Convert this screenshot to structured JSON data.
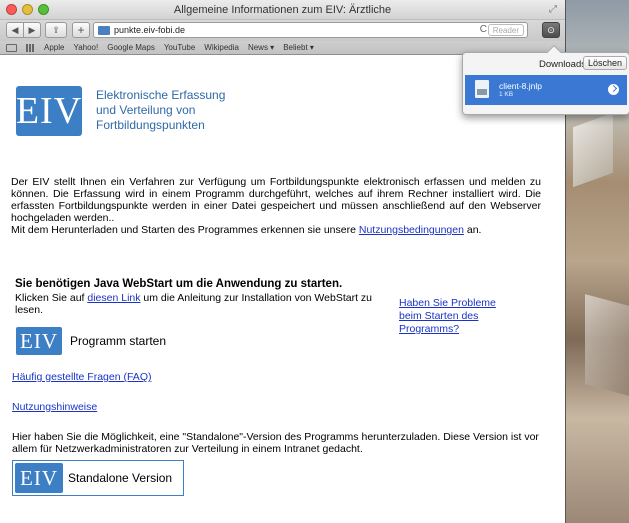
{
  "window": {
    "title": "Allgemeine Informationen zum EIV: Ärztliche"
  },
  "toolbar": {
    "back_glyph": "◀",
    "forward_glyph": "▶",
    "share_glyph": "⇪",
    "add_glyph": "+",
    "url": "punkte.eiv-fobi.de",
    "reload_glyph": "C",
    "reader_label": "Reader",
    "downloads_glyph": "⊙"
  },
  "bookmarks": {
    "items": [
      "Apple",
      "Yahoo!",
      "Google Maps",
      "YouTube",
      "Wikipedia",
      "News ▾",
      "Beliebt ▾"
    ]
  },
  "page": {
    "logo_text": "EIV",
    "logo_title": [
      "Elektronische Erfassung",
      "und Verteilung von",
      "Fortbildungspunkten"
    ],
    "intro_text": "Der EIV stellt Ihnen ein Verfahren zur Verfügung um Fortbildungspunkte elektronisch erfassen und melden zu können. Die Erfassung wird in einem Programm durchgeführt, welches auf ihrem Rechner installiert wird. Die erfassten Fortbildungspunkte werden in einer Datei gespeichert und müssen anschließend auf den Webserver hochgeladen werden..",
    "intro_text2": "Mit dem Herunterladen und Starten des Programmes erkennen sie unsere ",
    "terms_link": "Nutzungsbedingungen",
    "intro_end": " an.",
    "java_heading": "Sie benötigen Java WebStart um die Anwendung zu starten.",
    "java_text_pre": "Klicken Sie auf ",
    "java_link": "diesen Link",
    "java_text_post": " um die Anleitung zur Installation von WebStart zu lesen.",
    "problems_link": "Haben Sie Probleme beim Starten des Programms?",
    "start_label": "Programm starten",
    "faq_link": "Häufig gestellte Fragen (FAQ)",
    "hints_link": "Nutzungshinweise",
    "standalone_text": "Hier haben Sie die Möglichkeit, eine \"Standalone\"-Version des Programms herunterzuladen. Diese Version ist vor allem für Netzwerkadministratoren zur Verteilung in einem Intranet gedacht.",
    "standalone_label": "Standalone Version"
  },
  "downloads": {
    "title": "Downloads",
    "clear_label": "Löschen",
    "file_name": "client-8.jnlp",
    "file_size": "1 KB",
    "file_icon_label": "JNLP"
  },
  "colors": {
    "accent": "#3d7fc4",
    "link": "#1a33c4",
    "selection": "#3b78d4"
  }
}
